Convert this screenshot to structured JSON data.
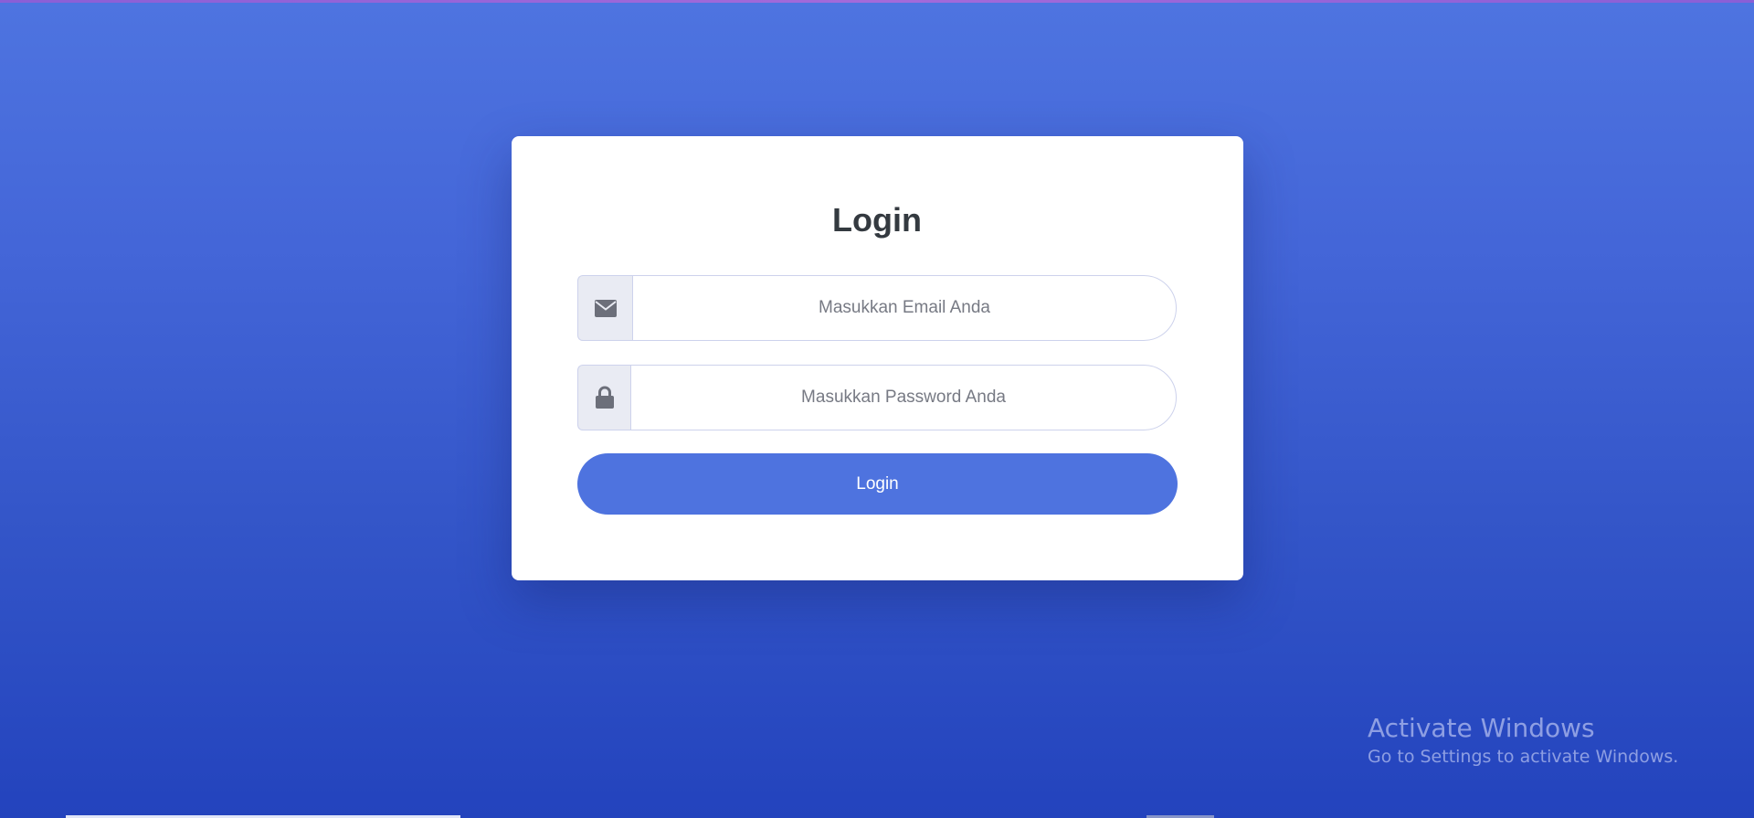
{
  "login": {
    "title": "Login",
    "email": {
      "icon": "envelope-icon",
      "placeholder": "Masukkan Email Anda",
      "value": ""
    },
    "password": {
      "icon": "lock-icon",
      "placeholder": "Masukkan Password Anda",
      "value": ""
    },
    "button_label": "Login"
  },
  "os_overlay": {
    "activate_title": "Activate Windows",
    "activate_subtitle": "Go to Settings to activate Windows."
  },
  "colors": {
    "background_top": "#4e74e0",
    "background_bottom": "#2343bd",
    "accent": "#4e73df",
    "card": "#ffffff",
    "title_text": "#343a40",
    "icon": "#6c6f7a"
  }
}
